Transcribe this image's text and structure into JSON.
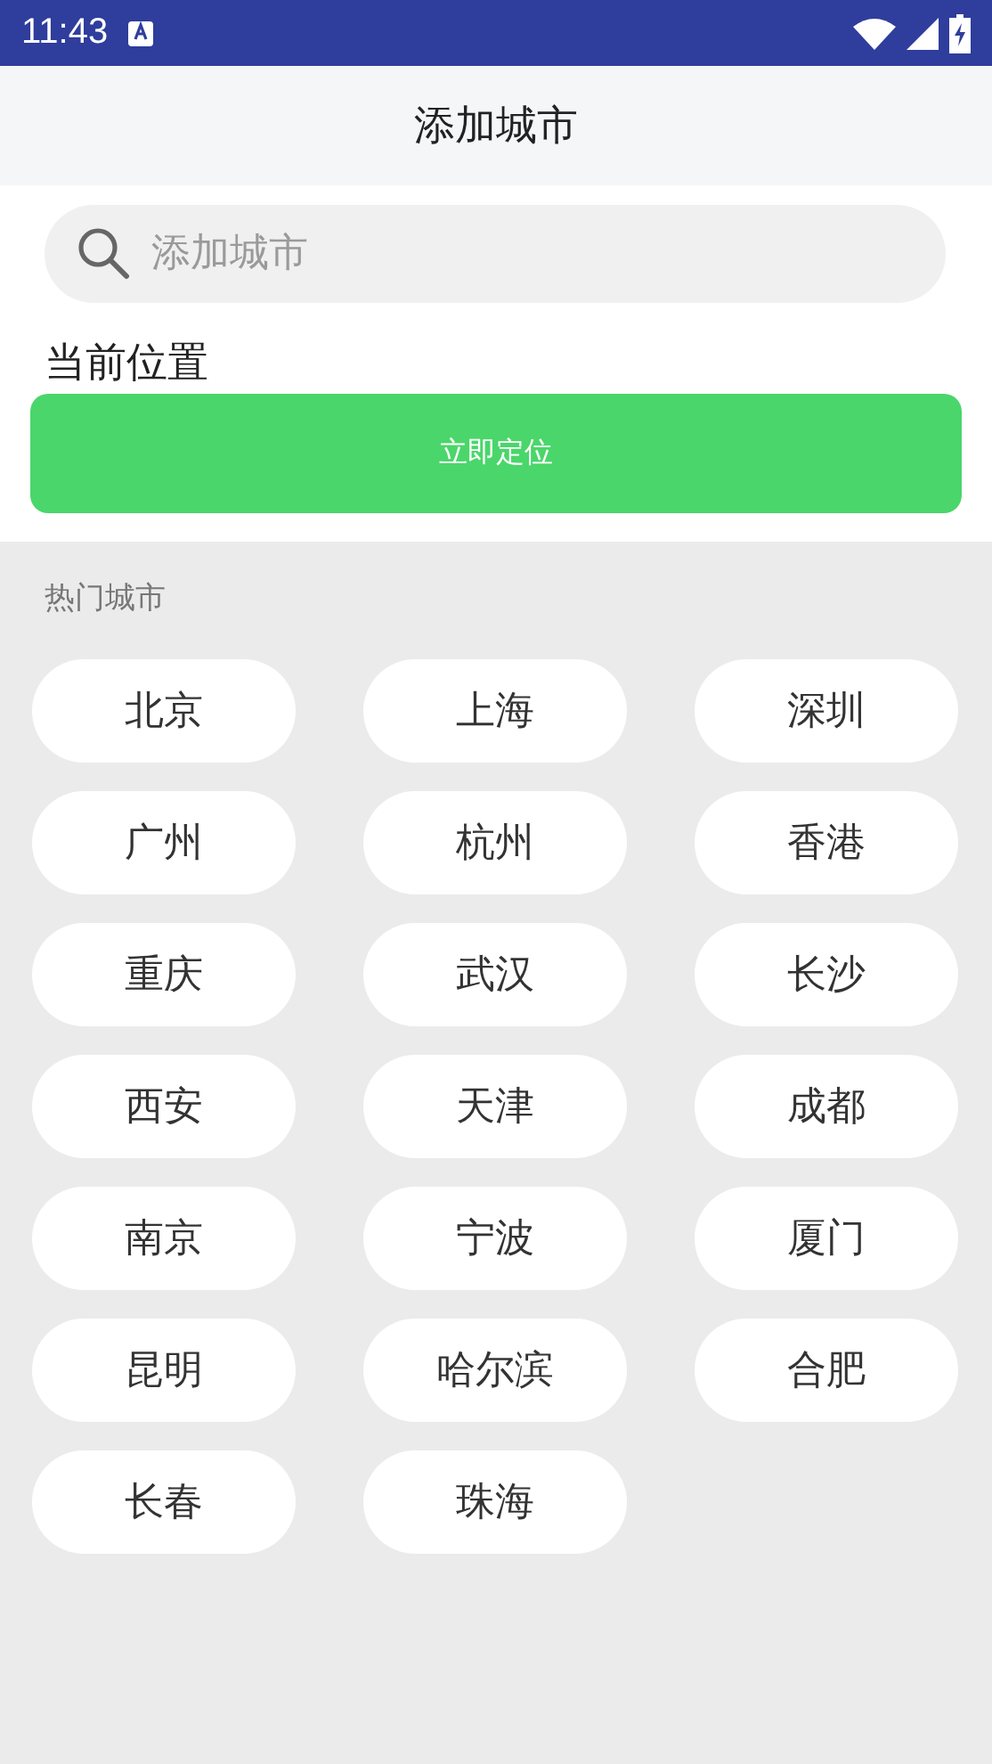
{
  "status_bar": {
    "time": "11:43"
  },
  "header": {
    "title": "添加城市"
  },
  "search": {
    "placeholder": "添加城市"
  },
  "location": {
    "label": "当前位置",
    "button": "立即定位"
  },
  "hot_cities": {
    "title": "热门城市",
    "cities": [
      "北京",
      "上海",
      "深圳",
      "广州",
      "杭州",
      "香港",
      "重庆",
      "武汉",
      "长沙",
      "西安",
      "天津",
      "成都",
      "南京",
      "宁波",
      "厦门",
      "昆明",
      "哈尔滨",
      "合肥",
      "长春",
      "珠海"
    ]
  }
}
